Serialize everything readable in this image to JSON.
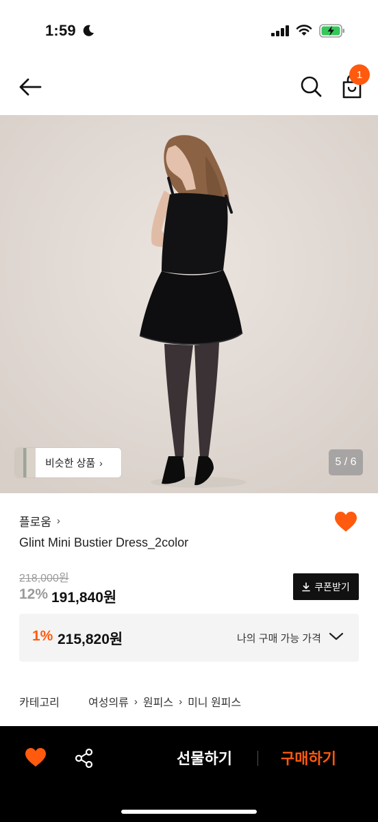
{
  "status_bar": {
    "time": "1:59"
  },
  "header": {
    "cart_count": "1"
  },
  "gallery": {
    "similar_label": "비슷한 상품",
    "similar_chevron": "›",
    "indicator": "5 / 6"
  },
  "product": {
    "brand": "플로움",
    "brand_chevron": "›",
    "title": "Glint Mini Bustier Dress_2color",
    "original_price": "218,000원",
    "discount_rate": "12%",
    "sale_price": "191,840원"
  },
  "coupon": {
    "label": "쿠폰받기"
  },
  "my_price": {
    "rate": "1%",
    "price": "215,820원",
    "label": "나의 구매 가능 가격"
  },
  "category": {
    "label": "카테고리",
    "path": [
      "여성의류",
      "원피스",
      "미니 원피스"
    ],
    "separator": "›"
  },
  "bottom_bar": {
    "gift_label": "선물하기",
    "buy_label": "구매하기"
  },
  "colors": {
    "accent": "#ff5a0e",
    "dark": "#111111",
    "price_box_bg": "#f4f4f4"
  }
}
